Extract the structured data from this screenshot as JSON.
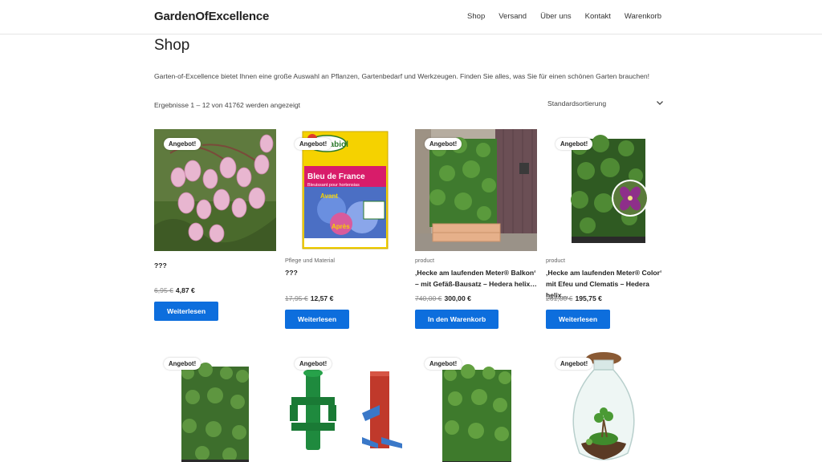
{
  "site": {
    "logo": "GardenOfExcellence"
  },
  "nav": [
    "Shop",
    "Versand",
    "Über uns",
    "Kontakt",
    "Warenkorb"
  ],
  "page": {
    "title": "Shop",
    "description": "Garten-of-Excellence bietet Ihnen eine große Auswahl an Pflanzen, Gartenbedarf und Werkzeugen. Finden Sie alles, was Sie für einen schönen Garten brauchen!",
    "result_count": "Ergebnisse 1 – 12 von 41762 werden angezeigt",
    "sort_selected": "Standardsortierung"
  },
  "badge_label": "Angebot!",
  "products": [
    {
      "category": "",
      "title": "???",
      "old_price": "6,95 €",
      "new_price": "4,87 €",
      "button": "Weiterlesen"
    },
    {
      "category": "Pflege und Material",
      "title": "???",
      "old_price": "17,95 €",
      "new_price": "12,57 €",
      "button": "Weiterlesen"
    },
    {
      "category": "product",
      "title": "‚Hecke am laufenden Meter® Balkon‘ – mit Gefäß-Bausatz – Hedera helix…",
      "old_price": "740,00 €",
      "new_price": "300,00 €",
      "button": "In den Warenkorb"
    },
    {
      "category": "product",
      "title": "‚Hecke am laufenden Meter® Color‘ mit Efeu und Clematis – Hedera helix…",
      "old_price": "261,00 €",
      "new_price": "195,75 €",
      "button": "Weiterlesen"
    }
  ],
  "packshot": {
    "brand": "Solabiol",
    "name": "Bleu de France",
    "sub": "Bleuissant pour hortensias",
    "avant": "Avant",
    "apres": "Après"
  },
  "colors": {
    "accent": "#0d6edd"
  }
}
